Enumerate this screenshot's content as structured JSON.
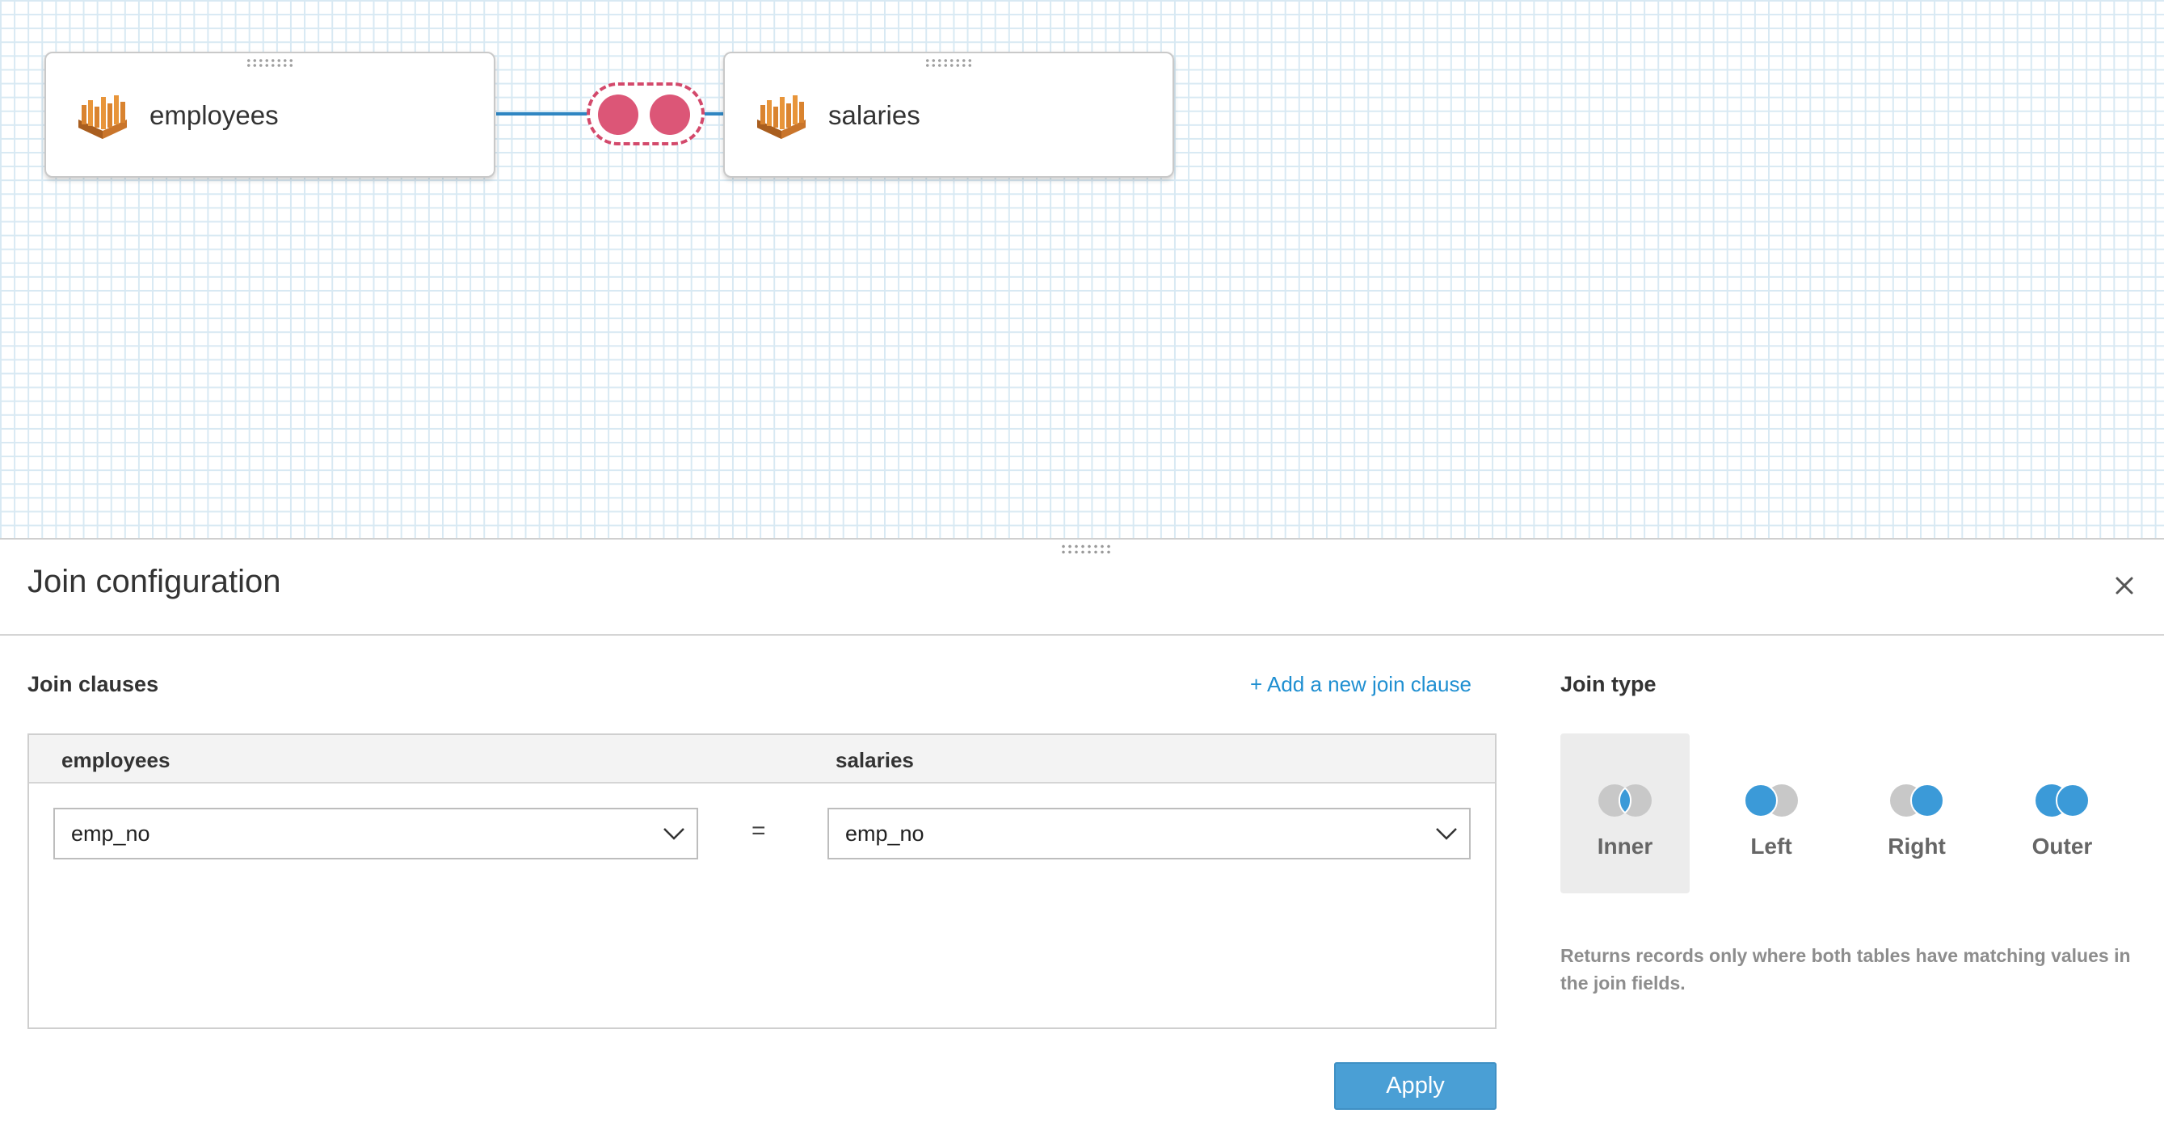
{
  "canvas": {
    "nodes": [
      {
        "label": "employees",
        "icon": "database-icon"
      },
      {
        "label": "salaries",
        "icon": "database-icon"
      }
    ],
    "join_node": {
      "icon": "inner-join-icon",
      "color": "#dc5677"
    },
    "connector_color": "#2f86c2",
    "grid_color": "#d8e9f3"
  },
  "panel": {
    "title": "Join configuration",
    "close_icon": "close-icon",
    "clauses": {
      "title": "Join clauses",
      "add_link": "+ Add a new join clause",
      "left_header": "employees",
      "right_header": "salaries",
      "rows": [
        {
          "left_value": "emp_no",
          "operator": "=",
          "right_value": "emp_no"
        }
      ]
    },
    "join_type": {
      "title": "Join type",
      "options": [
        "Inner",
        "Left",
        "Right",
        "Outer"
      ],
      "selected": "Inner",
      "description": "Returns records only where both tables have matching values in the join fields."
    },
    "apply_label": "Apply",
    "accent_color": "#4a9fd5"
  }
}
